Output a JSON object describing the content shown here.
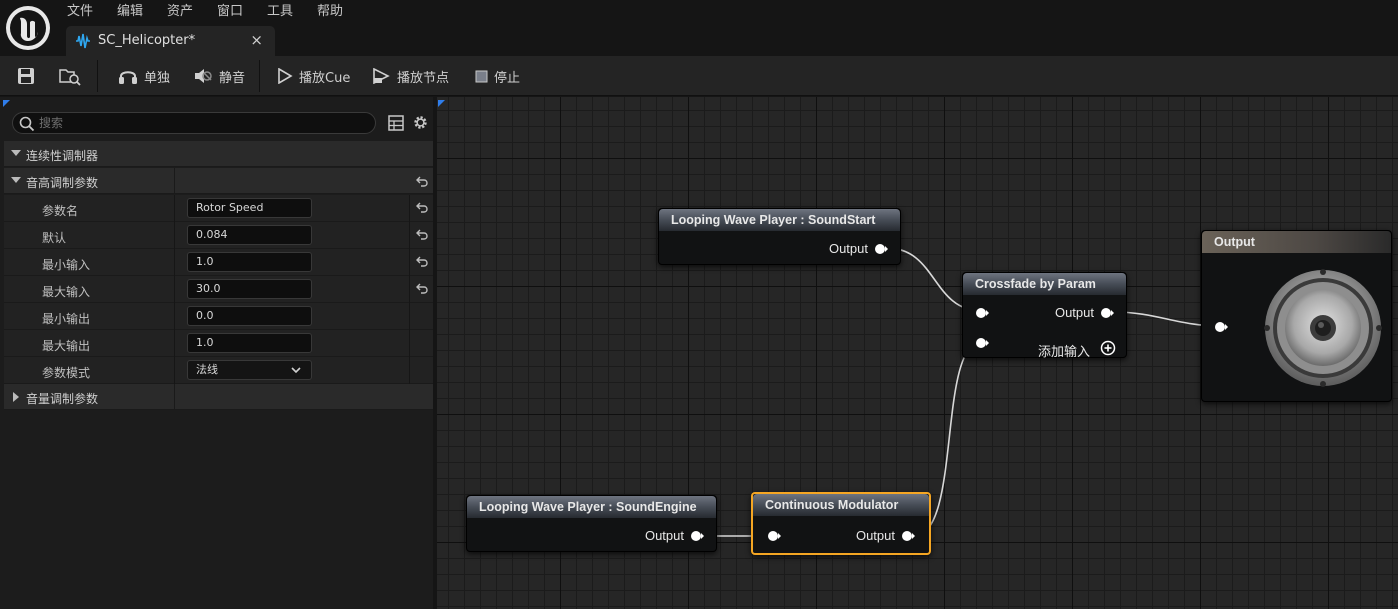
{
  "menu": {
    "items": [
      "文件",
      "编辑",
      "资产",
      "窗口",
      "工具",
      "帮助"
    ]
  },
  "document_tab": {
    "title": "SC_Helicopter*",
    "close": "×"
  },
  "toolbar": {
    "solo_label": "单独",
    "mute_label": "静音",
    "play_cue_label": "播放Cue",
    "play_node_label": "播放节点",
    "stop_label": "停止"
  },
  "details": {
    "search_placeholder": "搜索",
    "sections": {
      "continuous_modulator": "连续性调制器",
      "pitch_params": "音高调制参数",
      "volume_params": "音量调制参数"
    },
    "rows": [
      {
        "label": "参数名",
        "value": "Rotor Speed"
      },
      {
        "label": "默认",
        "value": "0.084"
      },
      {
        "label": "最小输入",
        "value": "1.0"
      },
      {
        "label": "最大输入",
        "value": "30.0"
      },
      {
        "label": "最小输出",
        "value": "0.0"
      },
      {
        "label": "最大输出",
        "value": "1.0"
      },
      {
        "label": "参数模式",
        "value": "法线"
      }
    ]
  },
  "graph": {
    "nodes": {
      "wave_start": {
        "title": "Looping Wave Player : SoundStart",
        "output": "Output"
      },
      "crossfade": {
        "title": "Crossfade by Param",
        "output": "Output",
        "add_input": "添加输入"
      },
      "output": {
        "title": "Output"
      },
      "wave_engine": {
        "title": "Looping Wave Player : SoundEngine",
        "output": "Output"
      },
      "modulator": {
        "title": "Continuous Modulator",
        "output": "Output"
      }
    }
  },
  "colors": {
    "selection": "#f5a623",
    "accent": "#2f7dea",
    "background": "#151515"
  }
}
